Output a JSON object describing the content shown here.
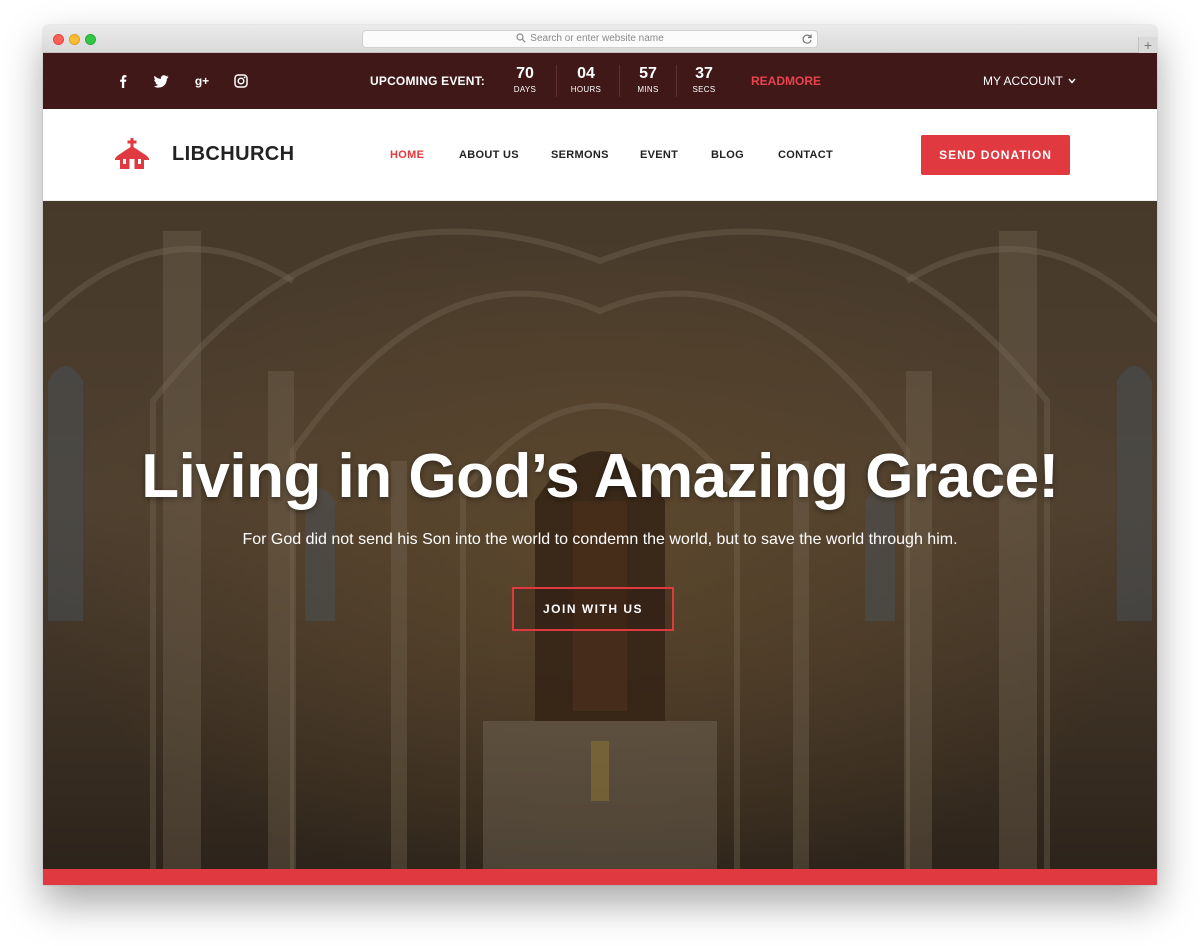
{
  "browser": {
    "address_placeholder": "Search or enter website name",
    "new_tab_symbol": "+"
  },
  "topbar": {
    "social_icons": [
      "facebook-icon",
      "twitter-icon",
      "google-plus-icon",
      "instagram-icon"
    ],
    "social_glyphs": [
      "f",
      "",
      "g+",
      ""
    ],
    "upcoming_label": "UPCOMING EVENT:",
    "countdown": [
      {
        "value": "70",
        "unit": "DAYS"
      },
      {
        "value": "04",
        "unit": "HOURS"
      },
      {
        "value": "57",
        "unit": "MINS"
      },
      {
        "value": "37",
        "unit": "SECS"
      }
    ],
    "readmore": "READMORE",
    "account": "MY ACCOUNT"
  },
  "navbar": {
    "brand": "LIBCHURCH",
    "items": [
      {
        "label": "HOME",
        "active": true
      },
      {
        "label": "ABOUT US",
        "active": false
      },
      {
        "label": "SERMONS",
        "active": false
      },
      {
        "label": "EVENT",
        "active": false
      },
      {
        "label": "BLOG",
        "active": false
      },
      {
        "label": "CONTACT",
        "active": false
      }
    ],
    "donate": "SEND DONATION"
  },
  "hero": {
    "title": "Living in God’s Amazing Grace!",
    "subtitle": "For God did not send his Son into the world to condemn the world, but to save the world through him.",
    "cta": "JOIN WITH US"
  },
  "colors": {
    "accent": "#e0393f",
    "topbar": "#401818"
  }
}
